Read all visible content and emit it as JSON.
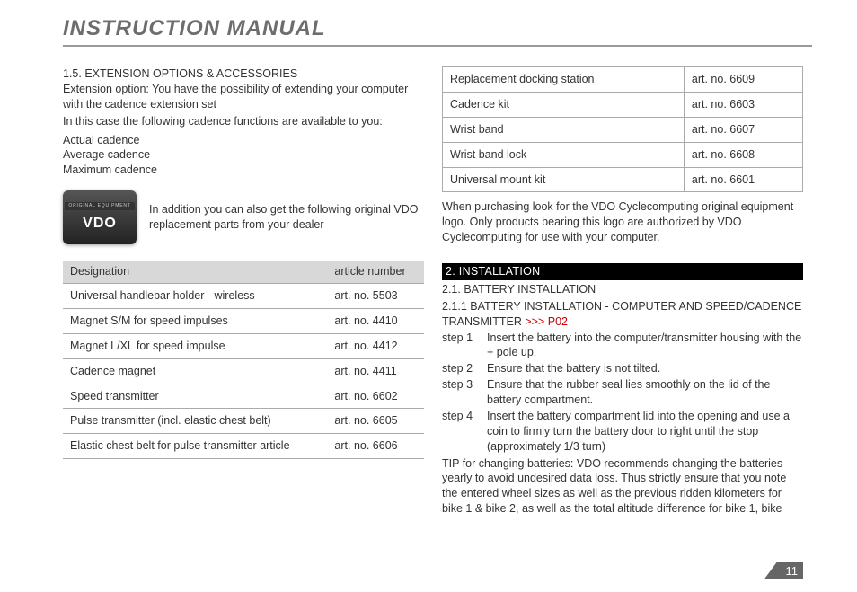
{
  "header": {
    "title": "INSTRUCTION MANUAL"
  },
  "left": {
    "sec15": "1.5. EXTENSION OPTIONS & ACCESSORIES",
    "ext_intro1": "Extension option: You have the possibility of extending your computer with the cadence extension set",
    "ext_intro2": "In this case the following cadence functions are available to you:",
    "cad1": "Actual cadence",
    "cad2": "Average cadence",
    "cad3": "Maximum cadence",
    "logo_text": "In addition you can also get the following original VDO replacement parts from your dealer",
    "logo_top": "ORIGINAL EQUIPMENT",
    "logo_main": "VDO",
    "th1": "Designation",
    "th2": "article number",
    "rows": [
      {
        "d": "Universal handlebar holder - wireless",
        "a": "art. no. 5503"
      },
      {
        "d": "Magnet S/M for speed impulses",
        "a": "art. no. 4410"
      },
      {
        "d": "Magnet L/XL for speed impulse",
        "a": "art. no. 4412"
      },
      {
        "d": "Cadence magnet",
        "a": "art. no. 4411"
      },
      {
        "d": "Speed transmitter",
        "a": " art. no. 6602"
      },
      {
        "d": "Pulse transmitter (incl. elastic chest belt)",
        "a": "art. no. 6605"
      },
      {
        "d": "Elastic chest belt for pulse transmitter article",
        "a": "art. no. 6606"
      }
    ]
  },
  "right": {
    "rows": [
      {
        "d": "Replacement docking station",
        "a": "art. no. 6609"
      },
      {
        "d": "Cadence kit",
        "a": "art. no. 6603"
      },
      {
        "d": "Wrist band",
        "a": "art. no. 6607"
      },
      {
        "d": "Wrist band lock",
        "a": "art. no. 6608"
      },
      {
        "d": "Universal mount kit",
        "a": "art. no. 6601"
      }
    ],
    "purchase_note": "When purchasing look for the VDO Cyclecomputing original equipment logo. Only products bearing this logo are authorized by VDO Cyclecomputing for use with your computer.",
    "sec2": " 2. INSTALLATION",
    "sec21": "2.1. BATTERY INSTALLATION",
    "sec211a": "2.1.1 BATTERY INSTALLATION - COMPUTER AND SPEED/CADENCE TRANSMITTER ",
    "sec211ref": ">>> P02",
    "steps": [
      {
        "l": "step 1",
        "t": "Insert the battery into the computer/transmitter housing with the + pole up."
      },
      {
        "l": "step 2",
        "t": "Ensure that the battery is not tilted."
      },
      {
        "l": "step 3",
        "t": "Ensure that the rubber seal lies smoothly on the lid of the battery compartment."
      },
      {
        "l": "step 4",
        "t": "Insert the battery compartment lid into the opening and use a coin to firmly turn the battery door to right until the stop (approximately 1/3 turn)"
      }
    ],
    "tip": "TIP for changing batteries: VDO recommends changing the batteries yearly to avoid undesired data loss. Thus strictly ensure that you note the entered wheel sizes as well as the previous ridden kilometers for bike 1 & bike 2, as well as the total altitude difference for bike 1, bike"
  },
  "page_number": "11"
}
